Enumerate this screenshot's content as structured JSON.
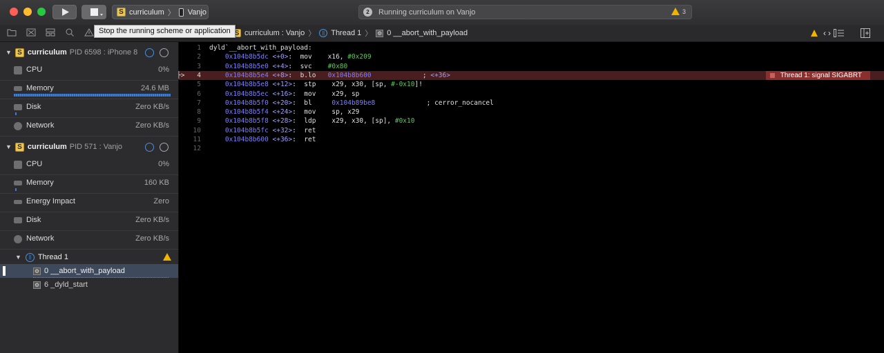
{
  "toolbar": {
    "scheme_name": "curriculum",
    "device_name": "Vanjo",
    "status_count": "2",
    "status_text": "Running curriculum on Vanjo",
    "warning_count": "3"
  },
  "tooltip": "Stop the running scheme or application",
  "breadcrumb": {
    "target": "curriculum : Vanjo",
    "thread": "Thread 1",
    "frame": "0 __abort_with_payload"
  },
  "sidebar": {
    "processes": [
      {
        "name": "curriculum",
        "pid": "PID 6598 : iPhone 8",
        "gauges": [
          {
            "label": "CPU",
            "value": "0%"
          },
          {
            "label": "Memory",
            "value": "24.6 MB"
          },
          {
            "label": "Disk",
            "value": "Zero KB/s"
          },
          {
            "label": "Network",
            "value": "Zero KB/s"
          }
        ]
      },
      {
        "name": "curriculum",
        "pid": "PID 571 : Vanjo",
        "gauges": [
          {
            "label": "CPU",
            "value": "0%"
          },
          {
            "label": "Memory",
            "value": "160 KB"
          },
          {
            "label": "Energy Impact",
            "value": "Zero"
          },
          {
            "label": "Disk",
            "value": "Zero KB/s"
          },
          {
            "label": "Network",
            "value": "Zero KB/s"
          }
        ]
      }
    ],
    "thread": "Thread 1",
    "frames": [
      "0 __abort_with_payload",
      "6 _dyld_start"
    ]
  },
  "editor": {
    "error_badge": "Thread 1: signal SIGABRT",
    "lines": [
      {
        "n": "1",
        "text": "dyld`__abort_with_payload:"
      },
      {
        "n": "2",
        "addr": "0x104b8b5dc",
        "off": "<+0>",
        "inst": "mov",
        "args": "x16, ",
        "imm": "#0x209",
        "comment": ""
      },
      {
        "n": "3",
        "addr": "0x104b8b5e0",
        "off": "<+4>",
        "inst": "svc",
        "args": "",
        "imm": "#0x80",
        "comment": ""
      },
      {
        "n": "4",
        "addr": "0x104b8b5e4",
        "off": "<+8>",
        "inst": "b.lo",
        "args": "",
        "target": "0x104b8b600",
        "comment": "; <+36>",
        "current": true
      },
      {
        "n": "5",
        "addr": "0x104b8b5e8",
        "off": "<+12>",
        "inst": "stp",
        "args": "x29, x30, [sp, ",
        "imm": "#-0x10",
        "tail": "]!",
        "comment": ""
      },
      {
        "n": "6",
        "addr": "0x104b8b5ec",
        "off": "<+16>",
        "inst": "mov",
        "args": "x29, sp",
        "comment": ""
      },
      {
        "n": "7",
        "addr": "0x104b8b5f0",
        "off": "<+20>",
        "inst": "bl",
        "args": "",
        "target": "0x104b89be8",
        "comment": "; cerror_nocancel"
      },
      {
        "n": "8",
        "addr": "0x104b8b5f4",
        "off": "<+24>",
        "inst": "mov",
        "args": "sp, x29",
        "comment": ""
      },
      {
        "n": "9",
        "addr": "0x104b8b5f8",
        "off": "<+28>",
        "inst": "ldp",
        "args": "x29, x30, [sp], ",
        "imm": "#0x10",
        "comment": ""
      },
      {
        "n": "10",
        "addr": "0x104b8b5fc",
        "off": "<+32>",
        "inst": "ret",
        "args": "",
        "comment": ""
      },
      {
        "n": "11",
        "addr": "0x104b8b600",
        "off": "<+36>",
        "inst": "ret",
        "args": "",
        "comment": ""
      },
      {
        "n": "12",
        "text": ""
      }
    ]
  }
}
